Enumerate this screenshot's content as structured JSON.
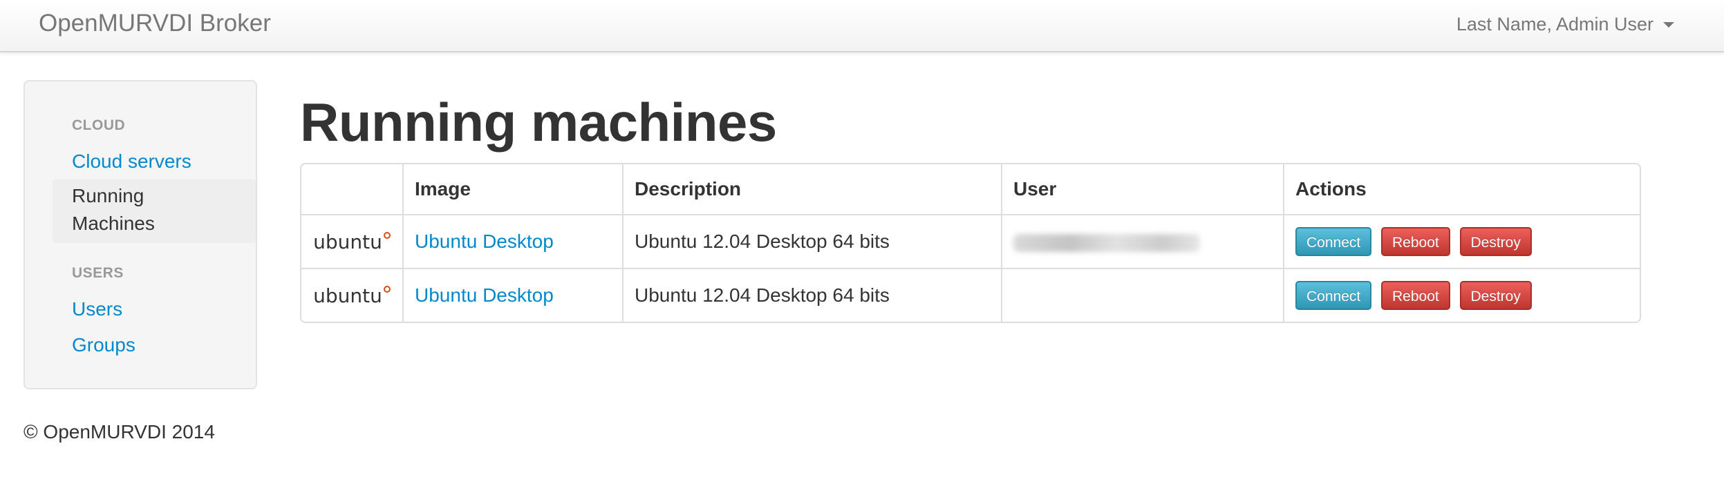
{
  "navbar": {
    "brand": "OpenMURVDI Broker",
    "user_label": "Last Name, Admin User"
  },
  "sidebar": {
    "sections": [
      {
        "header": "CLOUD",
        "items": [
          "Cloud servers",
          "Running Machines"
        ]
      },
      {
        "header": "USERS",
        "items": [
          "Users",
          "Groups"
        ]
      }
    ],
    "active_item": "Running Machines"
  },
  "page": {
    "title": "Running machines"
  },
  "table": {
    "columns": [
      "",
      "Image",
      "Description",
      "User",
      "Actions"
    ],
    "rows": [
      {
        "logo": "ubuntu",
        "image": "Ubuntu Desktop",
        "description": "Ubuntu 12.04 Desktop 64 bits",
        "user": "",
        "actions": [
          "Connect",
          "Reboot",
          "Destroy"
        ]
      },
      {
        "logo": "ubuntu",
        "image": "Ubuntu Desktop",
        "description": "Ubuntu 12.04 Desktop 64 bits",
        "user": "",
        "actions": [
          "Connect",
          "Reboot",
          "Destroy"
        ]
      }
    ]
  },
  "footer": {
    "text": "© OpenMURVDI 2014"
  },
  "colors": {
    "link": "#0088cc",
    "info": "#5bc0de",
    "danger": "#da4f49",
    "ubuntu_orange": "#dd4814"
  }
}
